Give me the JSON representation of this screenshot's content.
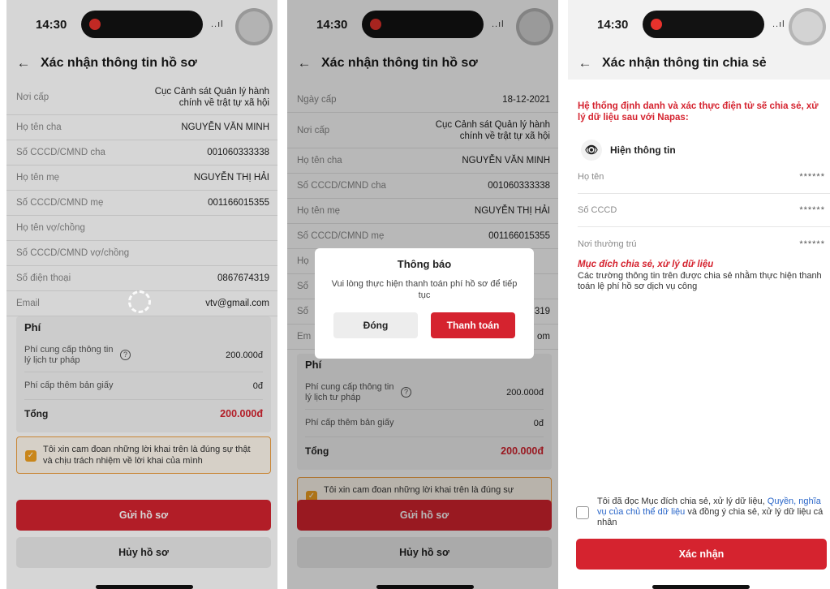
{
  "status": {
    "time": "14:30",
    "signal": "..ıl"
  },
  "screen1": {
    "title": "Xác nhận thông tin hồ sơ",
    "rows": [
      {
        "label": "Nơi cấp",
        "value": "Cục Cảnh sát Quản lý hành chính về trật tự xã hội"
      },
      {
        "label": "Họ tên cha",
        "value": "NGUYỄN VĂN MINH"
      },
      {
        "label": "Số CCCD/CMND cha",
        "value": "001060333338"
      },
      {
        "label": "Họ tên mẹ",
        "value": "NGUYỄN THỊ HẢI"
      },
      {
        "label": "Số CCCD/CMND mẹ",
        "value": "001166015355"
      },
      {
        "label": "Họ tên vợ/chồng",
        "value": ""
      },
      {
        "label": "Số CCCD/CMND vợ/chồng",
        "value": ""
      },
      {
        "label": "Số điện thoại",
        "value": "0867674319"
      },
      {
        "label": "Email",
        "value": "vtv@gmail.com"
      }
    ],
    "fee": {
      "title": "Phí",
      "provide_label": "Phí cung cấp thông tin lý lịch tư pháp",
      "provide_value": "200.000đ",
      "extra_label": "Phí cấp thêm bản giấy",
      "extra_value": "0đ",
      "total_label": "Tổng",
      "total_value": "200.000đ"
    },
    "commitment": "Tôi xin cam đoan những lời khai trên là đúng sự thật và chịu trách nhiệm về lời khai của mình",
    "submit": "Gửi hồ sơ",
    "cancel": "Hủy hồ sơ"
  },
  "screen2": {
    "title": "Xác nhận thông tin hồ sơ",
    "rows": [
      {
        "label": "Ngày cấp",
        "value": "18-12-2021"
      },
      {
        "label": "Nơi cấp",
        "value": "Cục Cảnh sát Quản lý hành chính về trật tự xã hội"
      },
      {
        "label": "Họ tên cha",
        "value": "NGUYỄN VĂN MINH"
      },
      {
        "label": "Số CCCD/CMND cha",
        "value": "001060333338"
      },
      {
        "label": "Họ tên mẹ",
        "value": "NGUYỄN THỊ HẢI"
      },
      {
        "label": "Số CCCD/CMND mẹ",
        "value": "001166015355"
      },
      {
        "label": "Họ",
        "value": ""
      },
      {
        "label": "Số",
        "value": ""
      },
      {
        "label": "Số",
        "value": "319"
      },
      {
        "label": "Em",
        "value": "om"
      }
    ],
    "fee": {
      "title": "Phí",
      "provide_label": "Phí cung cấp thông tin lý lịch tư pháp",
      "provide_value": "200.000đ",
      "extra_label": "Phí cấp thêm bản giấy",
      "extra_value": "0đ",
      "total_label": "Tổng",
      "total_value": "200.000đ"
    },
    "commitment": "Tôi xin cam đoan những lời khai trên là đúng sự",
    "submit": "Gửi hồ sơ",
    "cancel": "Hủy hồ sơ",
    "modal": {
      "title": "Thông báo",
      "message": "Vui lòng thực hiện thanh toán phí hồ sơ để tiếp tục",
      "close": "Đóng",
      "pay": "Thanh toán"
    }
  },
  "screen3": {
    "title": "Xác nhận thông tin chia sẻ",
    "intro": "Hệ thống định danh và xác thực điện tử sẽ chia sẻ, xử lý dữ liệu sau với Napas:",
    "show_info": "Hiện thông tin",
    "fields": [
      {
        "label": "Họ tên",
        "value": "******"
      },
      {
        "label": "Số CCCD",
        "value": "******"
      },
      {
        "label": "Nơi thường trú",
        "value": "******"
      }
    ],
    "purpose_title": "Mục đích chia sẻ, xử lý dữ liệu",
    "purpose_desc": "Các trường thông tin trên được chia sẻ nhằm thực hiện thanh toán lệ phí hồ sơ dịch vụ công",
    "agree_pre": "Tôi đã đọc Mục đích chia sẻ, xử lý dữ liệu, ",
    "agree_link": "Quyền, nghĩa vụ của chủ thể dữ liệu",
    "agree_post": " và đồng ý chia sẻ, xử lý dữ liệu cá nhân",
    "confirm": "Xác nhận"
  }
}
